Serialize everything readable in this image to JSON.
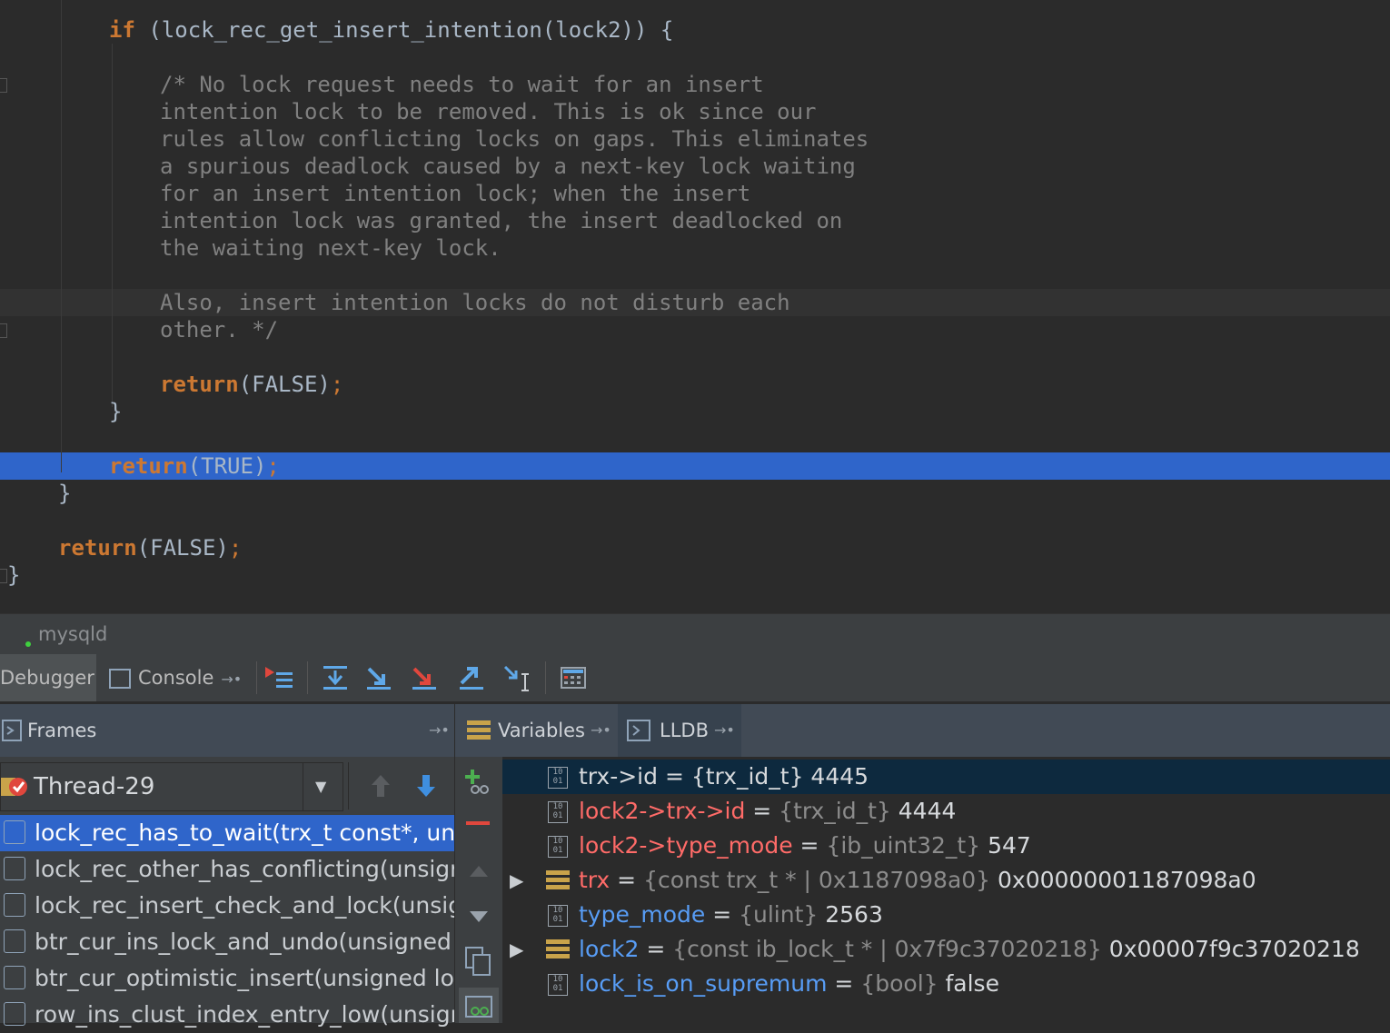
{
  "editor": {
    "lines": [
      {
        "kind": "code",
        "text": "if (lock_rec_get_insert_intention(lock2)) {"
      },
      {
        "kind": "comment",
        "text": "/* No lock request needs to wait for an insert"
      },
      {
        "kind": "comment",
        "text": "intention lock to be removed. This is ok since our"
      },
      {
        "kind": "comment",
        "text": "rules allow conflicting locks on gaps. This eliminates"
      },
      {
        "kind": "comment",
        "text": "a spurious deadlock caused by a next-key lock waiting"
      },
      {
        "kind": "comment",
        "text": "for an insert intention lock; when the insert"
      },
      {
        "kind": "comment",
        "text": "intention lock was granted, the insert deadlocked on"
      },
      {
        "kind": "comment",
        "text": "the waiting next-key lock."
      },
      {
        "kind": "comment",
        "text": "Also, insert intention locks do not disturb each"
      },
      {
        "kind": "comment",
        "text": "other. */"
      },
      {
        "kind": "return",
        "kw": "return",
        "arg": "(FALSE)",
        "semi": ";"
      },
      {
        "kind": "code",
        "text": "}"
      },
      {
        "kind": "return",
        "kw": "return",
        "arg": "(TRUE)",
        "semi": ";"
      },
      {
        "kind": "code",
        "text": "}"
      },
      {
        "kind": "return",
        "kw": "return",
        "arg": "(FALSE)",
        "semi": ";"
      },
      {
        "kind": "code",
        "text": "}"
      }
    ],
    "if_kw": "if",
    "if_rest": " (lock_rec_get_insert_intention(lock2)) {"
  },
  "status": {
    "process": "mysqld"
  },
  "toolbar": {
    "debugger_tab": "Debugger",
    "console_tab": "Console"
  },
  "panels": {
    "frames_label": "Frames",
    "variables_label": "Variables",
    "lldb_label": "LLDB"
  },
  "frames": {
    "thread": "Thread-29",
    "items": [
      "lock_rec_has_to_wait(trx_t const*, unsigned long, lock_t const*, unsigned long)",
      "lock_rec_other_has_conflicting(unsigned long, buf_block_t const*)",
      "lock_rec_insert_check_and_lock(unsigned long, rec_t const*)",
      "btr_cur_ins_lock_and_undo(unsigned long, btr_cur_t*)",
      "btr_cur_optimistic_insert(unsigned long, btr_cur_t*)",
      "row_ins_clust_index_entry_low(unsigned long, unsigned long)"
    ]
  },
  "variables": [
    {
      "name": "trx->id",
      "eq": " = ",
      "type": "{trx_id_t}",
      "value": " 4445",
      "color": "white",
      "icon": "watch",
      "expand": ""
    },
    {
      "name": "lock2->trx->id",
      "eq": " = ",
      "type": "{trx_id_t}",
      "value": " 4444",
      "color": "red",
      "icon": "watch",
      "expand": ""
    },
    {
      "name": "lock2->type_mode",
      "eq": " = ",
      "type": "{ib_uint32_t}",
      "value": " 547",
      "color": "red",
      "icon": "watch",
      "expand": ""
    },
    {
      "name": "trx",
      "eq": " = ",
      "type": "{const trx_t * | 0x1187098a0}",
      "value": " 0x00000001187098a0",
      "color": "red",
      "icon": "struct",
      "expand": "▶"
    },
    {
      "name": "type_mode",
      "eq": " = ",
      "type": "{ulint}",
      "value": " 2563",
      "color": "blue",
      "icon": "watch",
      "expand": ""
    },
    {
      "name": "lock2",
      "eq": " = ",
      "type": "{const ib_lock_t * | 0x7f9c37020218}",
      "value": " 0x00007f9c37020218",
      "color": "blue",
      "icon": "struct",
      "expand": "▶"
    },
    {
      "name": "lock_is_on_supremum",
      "eq": " = ",
      "type": "{bool}",
      "value": " false",
      "color": "blue",
      "icon": "watch",
      "expand": ""
    }
  ],
  "colors": {
    "accent": "#2f65ca",
    "keyword": "#cc7832",
    "comment": "#808080",
    "changed": "#ff6b68",
    "local": "#589df6"
  }
}
